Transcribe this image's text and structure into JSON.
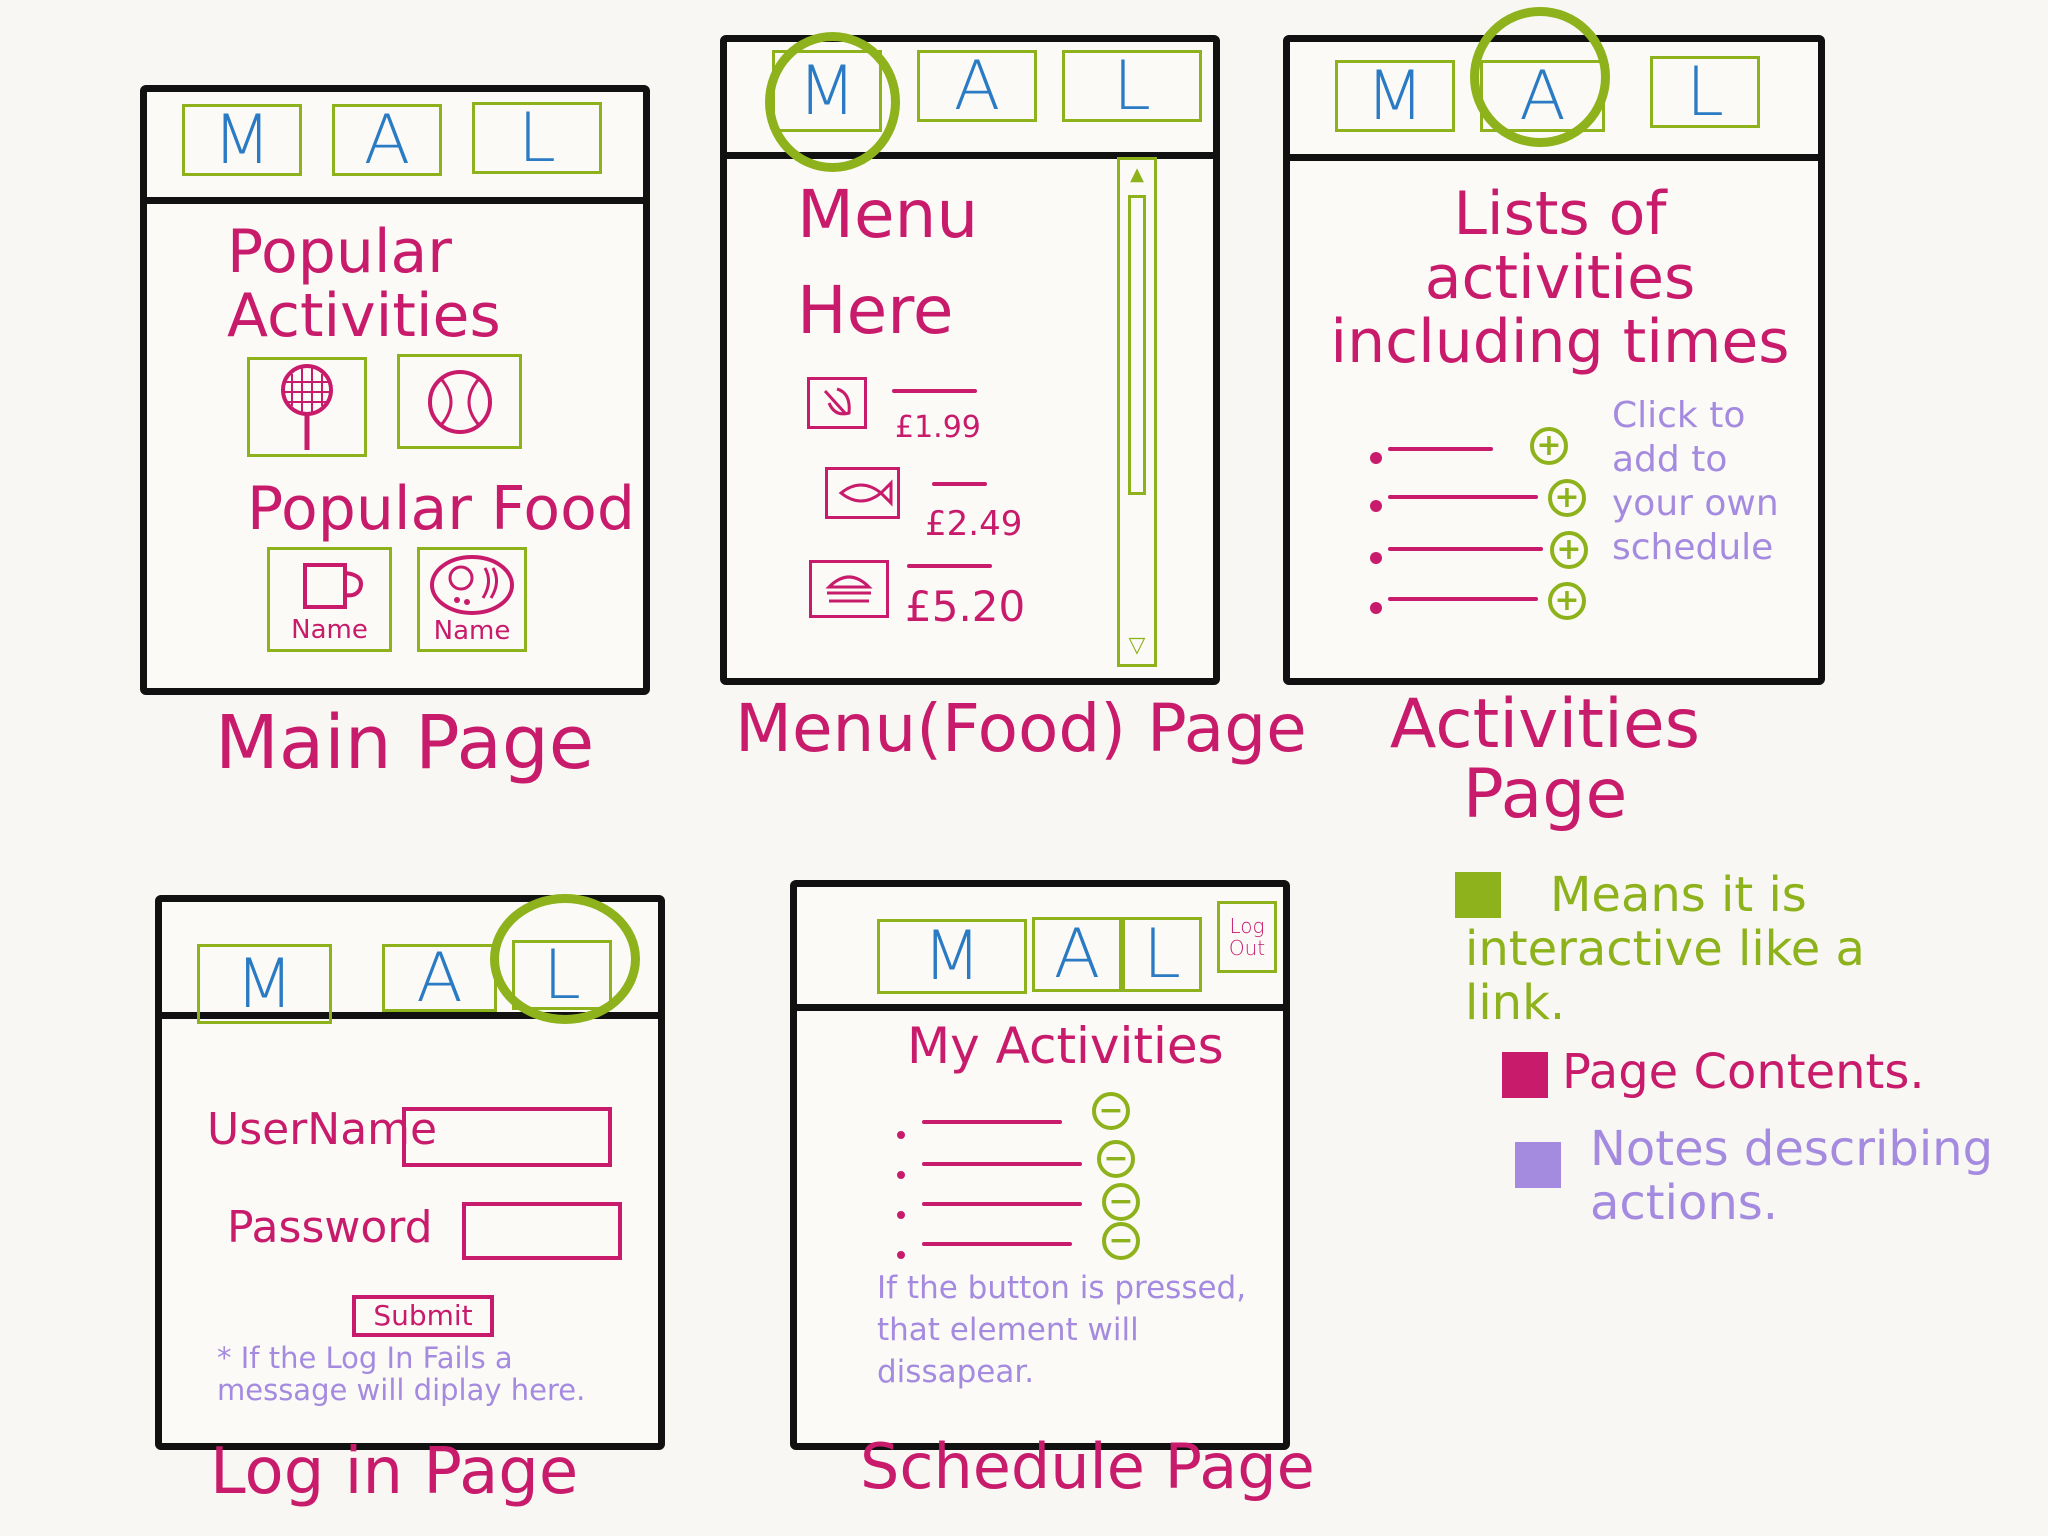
{
  "nav_tabs": [
    "M",
    "A",
    "L"
  ],
  "main_page": {
    "caption": "Main Page",
    "activities_heading": "Popular Activities",
    "food_heading": "Popular Food",
    "food_items": [
      "Name",
      "Name"
    ]
  },
  "menu_page": {
    "caption": "Menu(Food) Page",
    "heading": "Menu Here",
    "prices": [
      "£1.99",
      "£2.49",
      "£5.20"
    ],
    "scroll_up": "▲",
    "scroll_down": "▽"
  },
  "activities_page": {
    "caption": "Activities Page",
    "heading": "Lists of activities including times",
    "note": "Click to add to your own schedule"
  },
  "login_page": {
    "caption": "Log in Page",
    "username_label": "UserName",
    "password_label": "Password",
    "submit_label": "Submit",
    "note": "* If the Log In Fails a message will diplay here."
  },
  "schedule_page": {
    "caption": "Schedule Page",
    "logout_label": "Log Out",
    "heading": "My Activities",
    "note": "If the button is pressed, that element will dissapear."
  },
  "legend": [
    {
      "text": "Means it is interactive like a link.",
      "color": "#8db21b"
    },
    {
      "text": "Page Contents.",
      "color": "#c81b6b"
    },
    {
      "text": "Notes describing actions.",
      "color": "#a58be0"
    }
  ],
  "colors": {
    "interactive": "#8db21b",
    "content": "#c81b6b",
    "notes": "#a58be0",
    "tab_letter": "#2a7bc4"
  }
}
